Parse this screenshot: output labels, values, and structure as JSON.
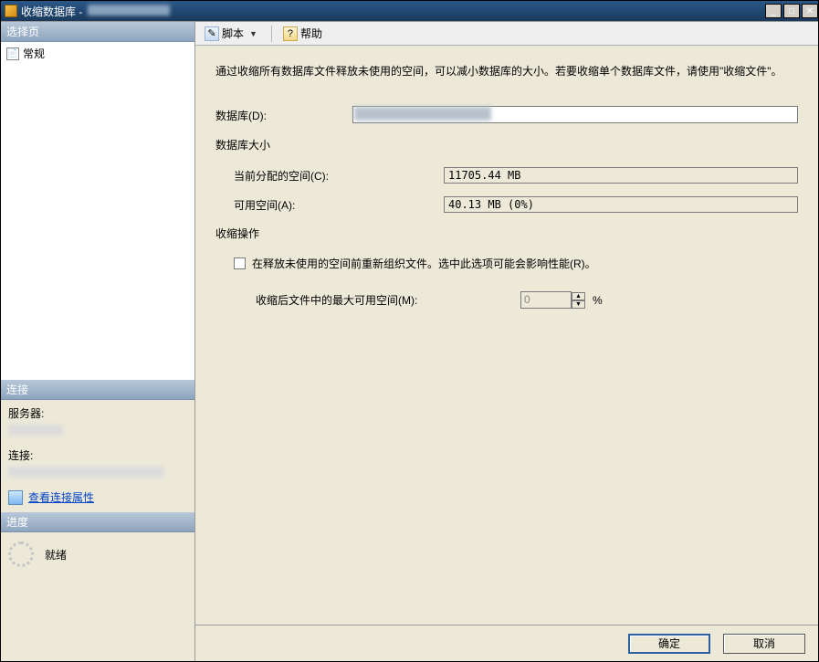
{
  "titlebar": {
    "title": "收缩数据库 - "
  },
  "sidebar": {
    "select_page_header": "选择页",
    "tree_item_general": "常规",
    "connection_header": "连接",
    "server_label": "服务器:",
    "connection_label": "连接:",
    "view_properties_link": "查看连接属性",
    "progress_header": "进度",
    "progress_status": "就绪"
  },
  "toolbar": {
    "script_label": "脚本",
    "help_label": "帮助"
  },
  "main": {
    "description": "通过收缩所有数据库文件释放未使用的空间，可以减小数据库的大小。若要收缩单个数据库文件，请使用\"收缩文件\"。",
    "database_label": "数据库(D):",
    "size_section": "数据库大小",
    "allocated_label": "当前分配的空间(C):",
    "allocated_value": "11705.44 MB",
    "available_label": "可用空间(A):",
    "available_value": "40.13 MB (0%)",
    "action_section": "收缩操作",
    "reorganize_checkbox": "在释放未使用的空间前重新组织文件。选中此选项可能会影响性能(R)。",
    "max_free_label": "收缩后文件中的最大可用空间(M):",
    "max_free_value": "0",
    "percent_sign": "%"
  },
  "footer": {
    "ok": "确定",
    "cancel": "取消"
  }
}
